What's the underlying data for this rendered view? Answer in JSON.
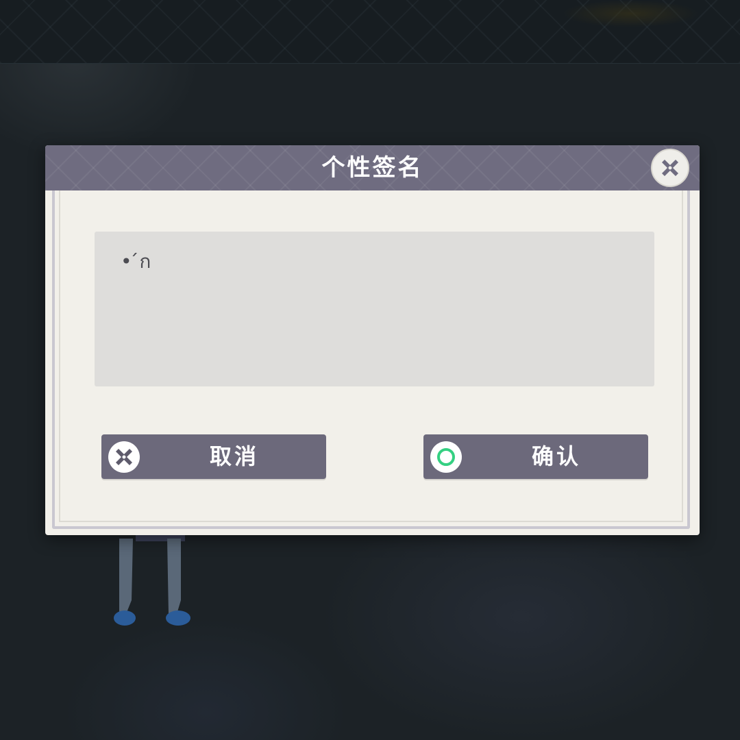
{
  "dialog": {
    "title": "个性签名",
    "signature_value": "• ́ก",
    "cancel_label": "取消",
    "confirm_label": "确认"
  },
  "icons": {
    "close": "close-icon",
    "cancel": "close-icon",
    "confirm": "circle-icon"
  },
  "colors": {
    "header": "#6f6c80",
    "button": "#6c697b",
    "panel": "#f2f0ea",
    "input": "#dedddb",
    "confirm_ring": "#35d082"
  }
}
